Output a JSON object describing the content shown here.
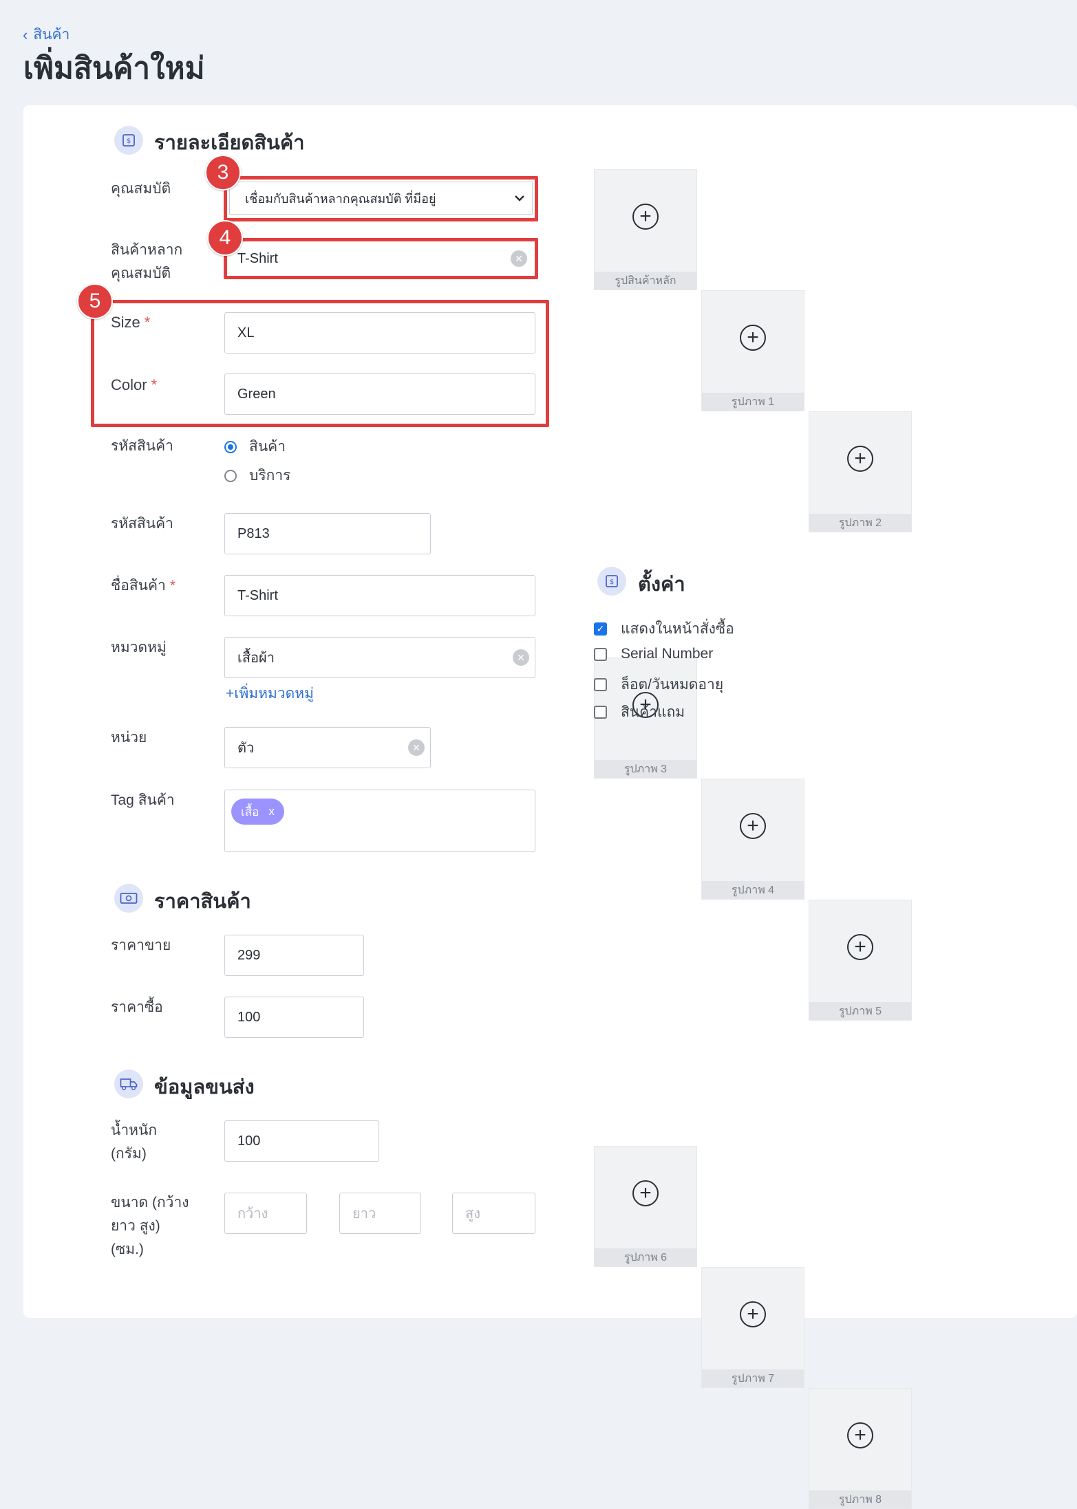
{
  "header": {
    "back_label": "สินค้า",
    "title": "เพิ่มสินค้าใหม่"
  },
  "details": {
    "title": "รายละเอียดสินค้า",
    "attribute_label": "คุณสมบัติ",
    "attribute_select": "เชื่อมกับสินค้าหลากคุณสมบัติ ที่มีอยู่",
    "variant_label_1": "สินค้าหลาก",
    "variant_label_2": "คุณสมบัติ",
    "variant_value": "T-Shirt",
    "size_label": "Size",
    "size_value": "XL",
    "color_label": "Color",
    "color_value": "Green",
    "code_type_label": "รหัสสินค้า",
    "type_product": "สินค้า",
    "type_service": "บริการ",
    "code_label": "รหัสสินค้า",
    "code_value": "P813",
    "name_label": "ชื่อสินค้า",
    "name_value": "T-Shirt",
    "category_label": "หมวดหมู่",
    "category_value": "เสื้อผ้า",
    "add_category": "+เพิ่มหมวดหมู่",
    "unit_label": "หน่วย",
    "unit_value": "ตัว",
    "tag_label": "Tag สินค้า",
    "tag_chip": "เสื้อ",
    "tag_remove": "x"
  },
  "required_mark": "*",
  "badges": {
    "b3": "3",
    "b4": "4",
    "b5": "5"
  },
  "price": {
    "title": "ราคาสินค้า",
    "sell_label": "ราคาขาย",
    "sell_value": "299",
    "buy_label": "ราคาซื้อ",
    "buy_value": "100"
  },
  "shipping": {
    "title": "ข้อมูลขนส่ง",
    "weight_label_1": "น้ำหนัก",
    "weight_label_2": "(กรัม)",
    "weight_value": "100",
    "dim_label_1": "ขนาด (กว้าง",
    "dim_label_2": "ยาว สูง)",
    "dim_label_3": "(ซม.)",
    "width_placeholder": "กว้าง",
    "length_placeholder": "ยาว",
    "height_placeholder": "สูง"
  },
  "images": {
    "plus_glyph": "+",
    "tiles": [
      "รูปสินค้าหลัก",
      "รูปภาพ 1",
      "รูปภาพ 2",
      "รูปภาพ 3",
      "รูปภาพ 4",
      "รูปภาพ 5",
      "รูปภาพ 6",
      "รูปภาพ 7",
      "รูปภาพ 8"
    ]
  },
  "settings": {
    "title": "ตั้งค่า",
    "options": [
      {
        "label": "แสดงในหน้าสั่งซื้อ",
        "checked": true
      },
      {
        "label": "Serial Number",
        "checked": false
      },
      {
        "label": "ล็อต/วันหมดอายุ",
        "checked": false
      },
      {
        "label": "สินค้าแถม",
        "checked": false
      }
    ]
  },
  "colors": {
    "accent": "#1a73e8",
    "highlight": "#e03e3e",
    "tag": "#9b93ff"
  }
}
